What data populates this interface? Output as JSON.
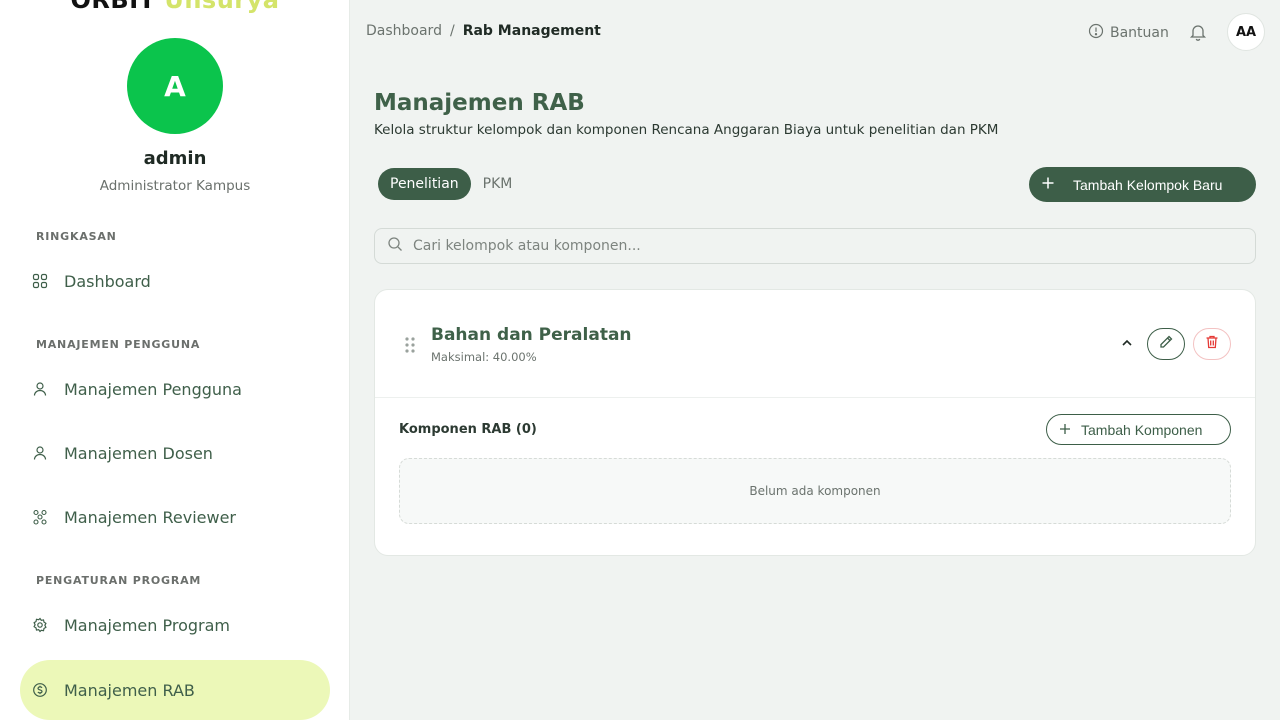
{
  "sidebar": {
    "brand_part1": "ORBIT",
    "brand_part2": "Unsurya",
    "avatar_letter": "A",
    "user_name": "admin",
    "user_role": "Administrator Kampus",
    "sections": [
      {
        "label": "RINGKASAN"
      },
      {
        "label": "MANAJEMEN PENGGUNA"
      },
      {
        "label": "PENGATURAN PROGRAM"
      }
    ],
    "items": [
      {
        "label": "Dashboard",
        "icon": "grid-icon"
      },
      {
        "label": "Manajemen Pengguna",
        "icon": "user-icon"
      },
      {
        "label": "Manajemen Dosen",
        "icon": "user-icon"
      },
      {
        "label": "Manajemen Reviewer",
        "icon": "users-network-icon"
      },
      {
        "label": "Manajemen Program",
        "icon": "gear-icon"
      },
      {
        "label": "Manajemen RAB",
        "icon": "money-icon",
        "active": true
      }
    ]
  },
  "topbar": {
    "breadcrumb": [
      "Dashboard",
      "/",
      "Rab Management"
    ],
    "help_label": "Bantuan",
    "user_initials": "AA"
  },
  "main": {
    "title": "Manajemen RAB",
    "subtitle": "Kelola struktur kelompok dan komponen Rencana Anggaran Biaya untuk penelitian dan PKM",
    "tabs": [
      {
        "label": "Penelitian",
        "active": true
      },
      {
        "label": "PKM",
        "active": false
      }
    ],
    "add_group_label": "Tambah Kelompok Baru",
    "search_placeholder": "Cari kelompok atau komponen...",
    "group": {
      "title": "Bahan dan Peralatan",
      "max_label": "Maksimal: 40.00%",
      "components_label": "Komponen RAB (0)",
      "add_component_label": "Tambah Komponen",
      "empty_label": "Belum ada komponen"
    }
  },
  "colors": {
    "primary": "#3d5e48",
    "accent_lime": "#ecf8b8",
    "avatar_green": "#0bc44c",
    "danger": "#e53935"
  }
}
